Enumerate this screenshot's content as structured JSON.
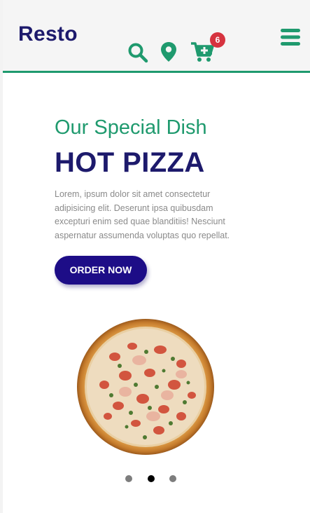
{
  "header": {
    "logo": "Resto",
    "cart_count": "6",
    "icons": [
      "search-icon",
      "map-pin-icon",
      "cart-plus-icon",
      "hamburger-menu-icon"
    ]
  },
  "hero": {
    "subtitle": "Our Special Dish",
    "title": "HOT PIZZA",
    "description": "Lorem, ipsum dolor sit amet consectetur adipisicing elit. Deserunt ipsa quibusdam excepturi enim sed quae blanditiis! Nesciunt aspernatur assumenda voluptas quo repellat.",
    "button_label": "ORDER NOW"
  },
  "slider": {
    "dot_count": 3,
    "active_index": 1
  },
  "colors": {
    "brand_green": "#1f9a6e",
    "brand_navy": "#1d1a6c",
    "button_bg": "#1d0d87",
    "badge_red": "#d6333f",
    "text_gray": "#8a8a8a"
  }
}
